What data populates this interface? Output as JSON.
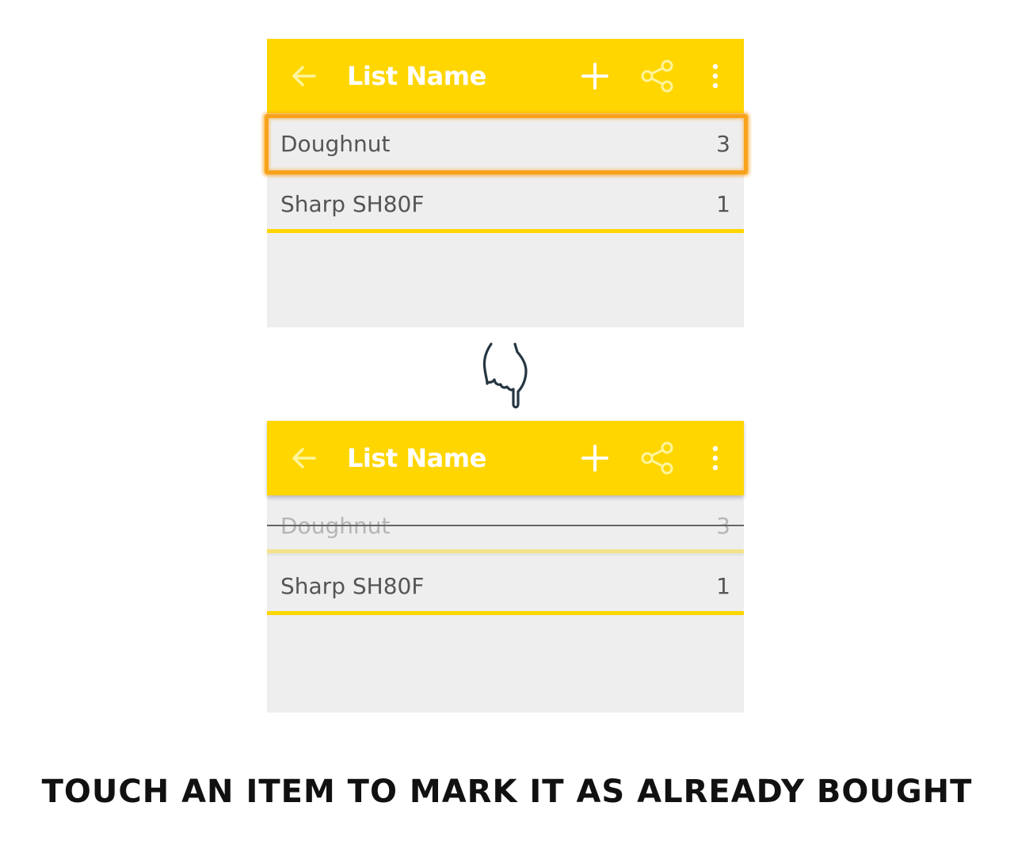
{
  "before": {
    "appbar": {
      "title": "List Name",
      "back_icon": "arrow-left-icon",
      "add_icon": "plus-icon",
      "share_icon": "share-icon",
      "more_icon": "more-vertical-icon"
    },
    "items": [
      {
        "name": "Doughnut",
        "quantity": "3",
        "highlighted": true
      },
      {
        "name": "Sharp SH80F",
        "quantity": "1"
      }
    ]
  },
  "after": {
    "appbar": {
      "title": "List Name",
      "back_icon": "arrow-left-icon",
      "add_icon": "plus-icon",
      "share_icon": "share-icon",
      "more_icon": "more-vertical-icon"
    },
    "items": [
      {
        "name": "Doughnut",
        "quantity": "3",
        "bought": true
      },
      {
        "name": "Sharp SH80F",
        "quantity": "1"
      }
    ]
  },
  "gesture_icon": "pointing-hand-icon",
  "caption": "Touch an item to mark it as already bought",
  "colors": {
    "accent": "#ffd600",
    "highlight": "#f8a21c",
    "icon_share": "#fff59d",
    "background": "#eeeeee"
  }
}
